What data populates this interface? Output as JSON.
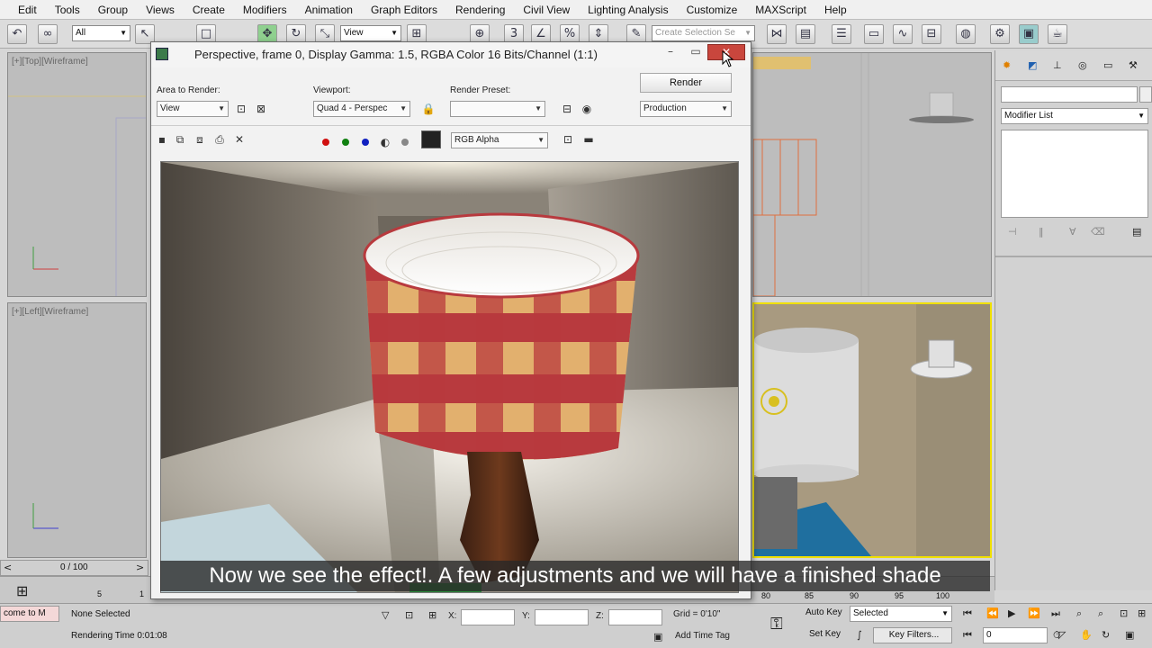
{
  "menu": [
    "Edit",
    "Tools",
    "Group",
    "Views",
    "Create",
    "Modifiers",
    "Animation",
    "Graph Editors",
    "Rendering",
    "Civil View",
    "Lighting Analysis",
    "Customize",
    "MAXScript",
    "Help"
  ],
  "toolbar": {
    "selection_filter": "All",
    "reference_coord": "View",
    "named_selection_placeholder": "Create Selection Se"
  },
  "viewports": {
    "top_label": "[+][Top][Wireframe]",
    "left_label": "[+][Left][Wireframe]"
  },
  "render_window": {
    "title": "Perspective, frame 0, Display Gamma: 1.5, RGBA Color 16 Bits/Channel (1:1)",
    "area_label": "Area to Render:",
    "area_value": "View",
    "viewport_label": "Viewport:",
    "viewport_value": "Quad 4 - Perspec",
    "preset_label": "Render Preset:",
    "preset_value": "",
    "render_button": "Render",
    "production_value": "Production",
    "channel_value": "RGB Alpha"
  },
  "subtitle": "Now we see the effect!. A few adjustments and we will have a finished shade",
  "command_panel": {
    "modifier_list": "Modifier List"
  },
  "timeline": {
    "frame_counter": "0 / 100",
    "ruler_left": [
      "5",
      "1"
    ],
    "ruler_right": [
      "80",
      "85",
      "90",
      "95",
      "100"
    ]
  },
  "status": {
    "script_listener": "come to M",
    "selection": "None Selected",
    "rendering_time": "Rendering Time  0:01:08",
    "x_label": "X:",
    "y_label": "Y:",
    "z_label": "Z:",
    "grid": "Grid = 0'10\"",
    "add_time_tag": "Add Time Tag",
    "auto_key": "Auto Key",
    "set_key": "Set Key",
    "selected": "Selected",
    "key_filters": "Key Filters...",
    "current_frame": "0"
  },
  "colors": {
    "close_button": "#c9463d",
    "selected_viewport_border": "#f0e000",
    "shade_red": "#b83a3e",
    "shade_tan": "#e2b06e"
  }
}
